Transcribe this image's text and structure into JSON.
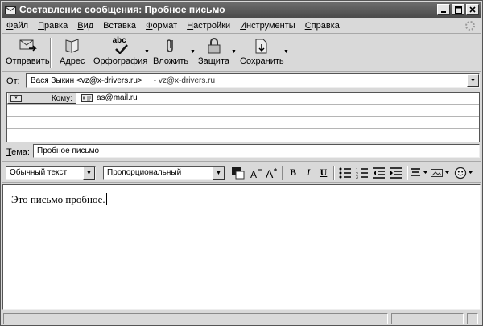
{
  "window": {
    "title": "Составление сообщения: Пробное письмо"
  },
  "menu": [
    {
      "u": "Ф",
      "rest": "айл"
    },
    {
      "u": "П",
      "rest": "равка"
    },
    {
      "u": "В",
      "rest": "ид"
    },
    {
      "u": "В",
      "rest": "ставка"
    },
    {
      "u": "Ф",
      "rest": "ормат"
    },
    {
      "u": "Н",
      "rest": "астройки"
    },
    {
      "u": "И",
      "rest": "нструменты"
    },
    {
      "u": "С",
      "rest": "правка"
    }
  ],
  "toolbar": {
    "send": "Отправить",
    "address": "Адрес",
    "spelling": "Орфография",
    "attach": "Вложить",
    "security": "Защита",
    "save": "Сохранить",
    "abc": "abc"
  },
  "from": {
    "label_u": "О",
    "label_rest": "т:",
    "value": "Вася Зыкин <vz@x-drivers.ru>",
    "account": "- vz@x-drivers.ru"
  },
  "recipients": {
    "field_label": "Кому:",
    "value": "as@mail.ru"
  },
  "subject": {
    "label_u": "Т",
    "label_rest": "ема:",
    "value": "Пробное письмо"
  },
  "format": {
    "paragraph_style": "Обычный текст",
    "font": "Пропорциональный",
    "bold": "B",
    "italic": "I",
    "underline": "U",
    "text_color": "#1a1a1a"
  },
  "message": {
    "body": "Это письмо пробное."
  }
}
